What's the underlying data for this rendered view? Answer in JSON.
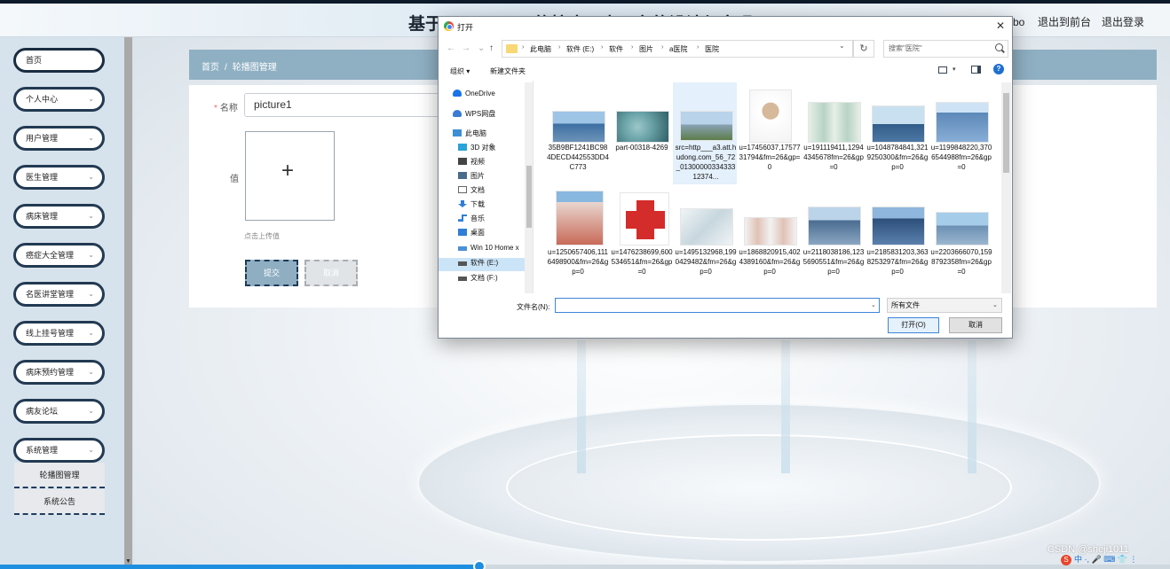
{
  "header": {
    "title": "基于SpringBoot的核瘟卫士平台的设计与实现",
    "user": "管理员 abo",
    "front_link": "退出到前台",
    "logout_link": "退出登录"
  },
  "sidebar": {
    "items": [
      {
        "label": "首页",
        "chevron": false
      },
      {
        "label": "个人中心",
        "chevron": true
      },
      {
        "label": "用户管理",
        "chevron": true
      },
      {
        "label": "医生管理",
        "chevron": true
      },
      {
        "label": "病床管理",
        "chevron": true
      },
      {
        "label": "癌症大全管理",
        "chevron": true
      },
      {
        "label": "名医讲堂管理",
        "chevron": true
      },
      {
        "label": "线上挂号管理",
        "chevron": true
      },
      {
        "label": "病床预约管理",
        "chevron": true
      },
      {
        "label": "病友论坛",
        "chevron": true
      },
      {
        "label": "系统管理",
        "chevron": true
      }
    ],
    "submenu": [
      {
        "label": "轮播图管理"
      },
      {
        "label": "系统公告"
      }
    ]
  },
  "breadcrumb": {
    "home": "首页",
    "separator": "/",
    "current": "轮播图管理"
  },
  "form": {
    "name_label": "名称",
    "required_mark": "*",
    "name_value": "picture1",
    "value_label": "值",
    "upload_plus": "+",
    "upload_tip": "点击上传值",
    "submit_label": "提交",
    "cancel_label": "取消"
  },
  "dialog": {
    "title": "打开",
    "close_glyph": "✕",
    "nav_back": "←",
    "nav_forward": "→",
    "nav_recent": "⌄",
    "nav_up": "↑",
    "path": [
      "此电脑",
      "软件 (E:)",
      "软件",
      "图片",
      "a医院",
      "医院"
    ],
    "path_arrow": "›",
    "dropdown_glyph": "⌄",
    "refresh_glyph": "↻",
    "search_placeholder": "搜索\"医院\"",
    "organize_label": "组织 ▾",
    "new_folder_label": "新建文件夹",
    "view_dropdown": "▾",
    "help_glyph": "?",
    "nav_pane": [
      {
        "label": "OneDrive",
        "icon": "cloud-icon",
        "color": "#1a73e8"
      },
      {
        "label": "WPS网盘",
        "icon": "cloud-icon",
        "color": "#3a7bd5"
      },
      {
        "label": "此电脑",
        "icon": "computer-icon",
        "color": "#3c8fd6"
      },
      {
        "label": "3D 对象",
        "icon": "cube-icon",
        "color": "#29a3d9"
      },
      {
        "label": "视频",
        "icon": "video-icon",
        "color": "#444444"
      },
      {
        "label": "图片",
        "icon": "picture-icon",
        "color": "#4a6c8c"
      },
      {
        "label": "文档",
        "icon": "document-icon",
        "color": "#666666"
      },
      {
        "label": "下载",
        "icon": "download-icon",
        "color": "#2f7ed8"
      },
      {
        "label": "音乐",
        "icon": "music-icon",
        "color": "#2f7ed8"
      },
      {
        "label": "桌面",
        "icon": "desktop-icon",
        "color": "#2f7ed8"
      },
      {
        "label": "Win 10 Home x",
        "icon": "drive-icon",
        "color": "#4a90d9"
      },
      {
        "label": "软件 (E:)",
        "icon": "drive-icon",
        "color": "#555555"
      },
      {
        "label": "文档 (F:)",
        "icon": "drive-icon",
        "color": "#555555"
      }
    ],
    "files": [
      {
        "name": "35B9BF1241BC984DECD442553DD4C773",
        "thumb": "thumb-hospital-building",
        "colors": [
          "#9ec4e6",
          "#3d6fa3"
        ]
      },
      {
        "name": "part-00318-4269",
        "thumb": "thumb-surgery",
        "colors": [
          "#6aa3a8",
          "#2f5f66"
        ]
      },
      {
        "name": "src=http___a3.att.hudong.com_56_72_0130000033433312374...",
        "thumb": "thumb-hospital-campus",
        "colors": [
          "#b9d3ea",
          "#5c7d4a"
        ]
      },
      {
        "name": "u=17456037,1757731794&fm=26&gp=0",
        "thumb": "thumb-doctor-portrait",
        "colors": [
          "#f3f3f3",
          "#d6b89a"
        ]
      },
      {
        "name": "u=191119411,12944345678fm=26&gp=0",
        "thumb": "thumb-medical-staff",
        "colors": [
          "#e6efe6",
          "#b7d3c5"
        ]
      },
      {
        "name": "u=1048784841,3219250300&fm=26&gp=0",
        "thumb": "thumb-doctor-ceremony",
        "colors": [
          "#c9e0f0",
          "#325d8a"
        ]
      },
      {
        "name": "u=1199848220,3706544988fm=26&gp=0",
        "thumb": "thumb-hospital-tower",
        "colors": [
          "#cde3f5",
          "#5c88b8"
        ]
      },
      {
        "name": "u=1250657406,1116498900&fm=26&gp=0",
        "thumb": "thumb-tall-hospital",
        "colors": [
          "#88b7e0",
          "#c96a58"
        ]
      },
      {
        "name": "u=1476238699,600534651&fm=26&gp=0",
        "thumb": "thumb-red-cross",
        "colors": [
          "#ffffff",
          "#d42b2b"
        ]
      },
      {
        "name": "u=1495132968,1990429482&fm=26&gp=0",
        "thumb": "thumb-nurse-patient",
        "colors": [
          "#f0f4f6",
          "#c7d7de"
        ]
      },
      {
        "name": "u=1868820915,4024389160&fm=26&gp=0",
        "thumb": "thumb-two-nurses",
        "colors": [
          "#f2f2f2",
          "#e0c2b5"
        ]
      },
      {
        "name": "u=2118038186,1235690551&fm=26&gp=0",
        "thumb": "thumb-hospital-plaza",
        "colors": [
          "#bcd4ea",
          "#4a6c90"
        ]
      },
      {
        "name": "u=2185831203,3638253297&fm=26&gp=0",
        "thumb": "thumb-hospital-modern",
        "colors": [
          "#8fb6dc",
          "#2c4f7a"
        ]
      },
      {
        "name": "u=2203666070,1598792358fm=26&gp=0",
        "thumb": "thumb-hospital-complex",
        "colors": [
          "#a5cdea",
          "#6b8fb3"
        ]
      }
    ],
    "filename_label": "文件名(N):",
    "filename_value": "",
    "filetype_value": "所有文件",
    "open_label": "打开(O)",
    "cancel_label": "取消"
  },
  "footer": {
    "watermark": "CSDN @sheji1011",
    "ime_logo": "S",
    "ime_text": "中 ·, 🎤 ⌨ 👕 ⋮",
    "progress": 0.41
  }
}
